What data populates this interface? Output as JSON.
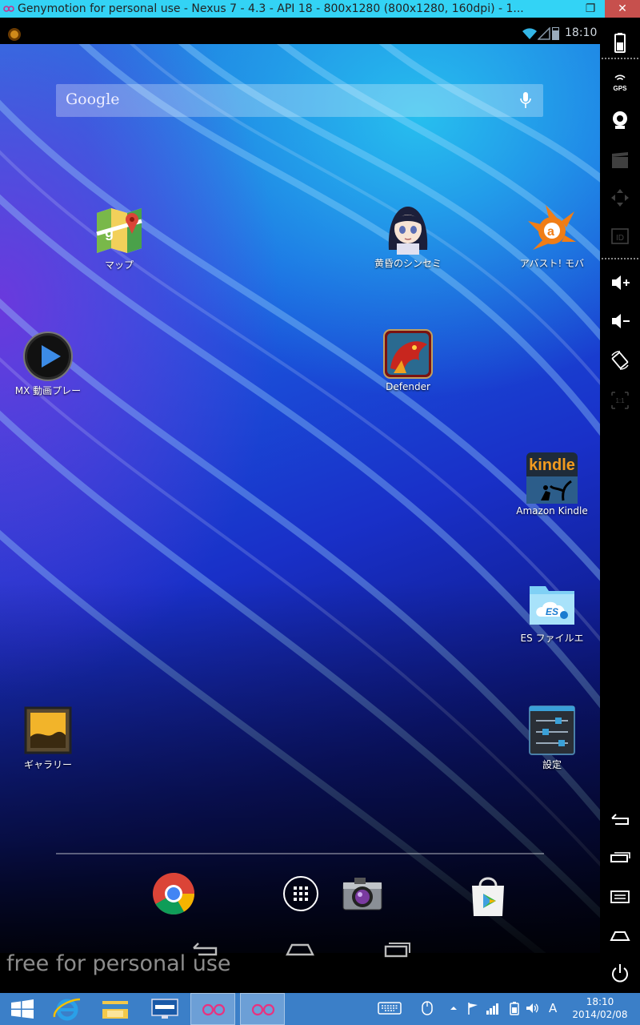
{
  "window": {
    "title": "Genymotion for personal use - Nexus 7 - 4.3 - API 18 - 800x1280 (800x1280, 160dpi) - 1...",
    "restore_glyph": "❐",
    "close_glyph": "✕"
  },
  "status_bar": {
    "time": "18:10"
  },
  "search": {
    "brand": "Google"
  },
  "apps": [
    {
      "label": "マップ",
      "icon": "maps-icon"
    },
    {
      "label": "黄昏のシンセミ",
      "icon": "anime-girl-icon"
    },
    {
      "label": "アバスト! モバ",
      "icon": "avast-icon"
    },
    {
      "label": "MX 動画プレー",
      "icon": "mx-player-icon"
    },
    {
      "label": "Defender",
      "icon": "dragon-icon"
    },
    {
      "label": "Amazon Kindle",
      "icon": "kindle-icon"
    },
    {
      "label": "ES ファイルエ",
      "icon": "es-file-explorer-icon"
    },
    {
      "label": "ギャラリー",
      "icon": "gallery-icon"
    },
    {
      "label": "設定",
      "icon": "settings-icon"
    }
  ],
  "kindle_word": "kindle",
  "dock": [
    "chrome-icon",
    "app-drawer-icon",
    "camera-icon",
    "play-store-icon"
  ],
  "watermark": "free for personal use",
  "sidebar": {
    "gps_label": "GPS",
    "id_label": "ID",
    "ratio_label": "1:1"
  },
  "taskbar": {
    "time": "18:10",
    "date": "2014/02/08",
    "ime_label": "A"
  },
  "colors": {
    "titlebar": "#33d3f5",
    "taskbar": "#3b7fc8",
    "close_button": "#c7504d"
  }
}
